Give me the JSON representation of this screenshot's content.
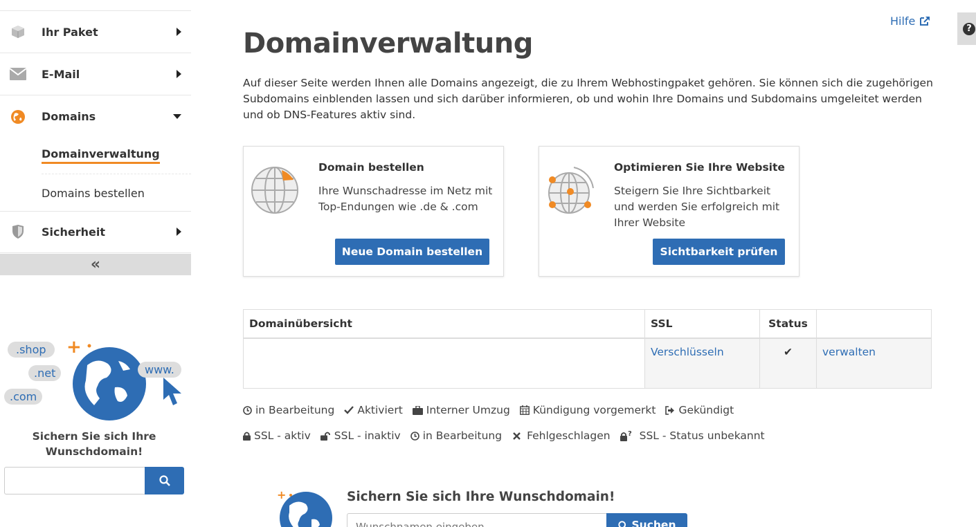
{
  "sidebar": {
    "items": [
      {
        "label": "Ihr Paket",
        "icon": "box-icon"
      },
      {
        "label": "E-Mail",
        "icon": "envelope-icon"
      },
      {
        "label": "Domains",
        "icon": "globe-icon"
      },
      {
        "label": "Sicherheit",
        "icon": "shield-icon"
      }
    ],
    "subitems": [
      {
        "label": "Domainverwaltung",
        "active": true
      },
      {
        "label": "Domains bestellen",
        "active": false
      }
    ],
    "collapse_label": "«",
    "promo": {
      "bubbles": [
        ".shop",
        ".net",
        ".com",
        "www."
      ],
      "text": "Sichern Sie sich Ihre Wunschdomain!"
    },
    "search": {
      "placeholder": "",
      "button_icon": "search-icon"
    }
  },
  "header": {
    "help_label": "Hilfe",
    "help_tab_label": "?"
  },
  "main": {
    "title": "Domainverwaltung",
    "intro": "Auf dieser Seite werden Ihnen alle Domains angezeigt, die zu Ihrem Webhostingpaket gehören. Sie können sich die zugehörigen Subdomains einblenden lassen und sich darüber informieren, ob und wohin Ihre Domains und Subdomains umgeleitet werden und ob DNS-Features aktiv sind.",
    "cards": [
      {
        "title": "Domain bestellen",
        "text": "Ihre Wunschadresse im Netz mit Top-Endungen wie .de & .com",
        "button": "Neue Domain bestellen"
      },
      {
        "title": "Optimieren Sie Ihre Website",
        "text": "Steigern Sie Ihre Sichtbarkeit und werden Sie erfolgreich mit Ihrer Website",
        "button": "Sichtbarkeit prüfen"
      }
    ],
    "table": {
      "headers": [
        "Domainübersicht",
        "SSL",
        "Status",
        ""
      ],
      "rows": [
        {
          "domain": "",
          "ssl": "Verschlüsseln",
          "status": "✔",
          "action": "verwalten"
        }
      ]
    },
    "legend_status": [
      "in Bearbeitung",
      "Aktiviert",
      "Interner Umzug",
      "Kündigung vorgemerkt",
      "Gekündigt"
    ],
    "legend_ssl": [
      "SSL - aktiv",
      "SSL - inaktiv",
      "in Bearbeitung",
      "Fehlgeschlagen",
      "SSL - Status unbekannt"
    ],
    "bottom": {
      "title": "Sichern Sie sich Ihre Wunschdomain!",
      "placeholder": "Wunschnamen eingeben",
      "button": "Suchen"
    }
  },
  "colors": {
    "accent": "#2e6db4",
    "orange": "#f08a24"
  }
}
